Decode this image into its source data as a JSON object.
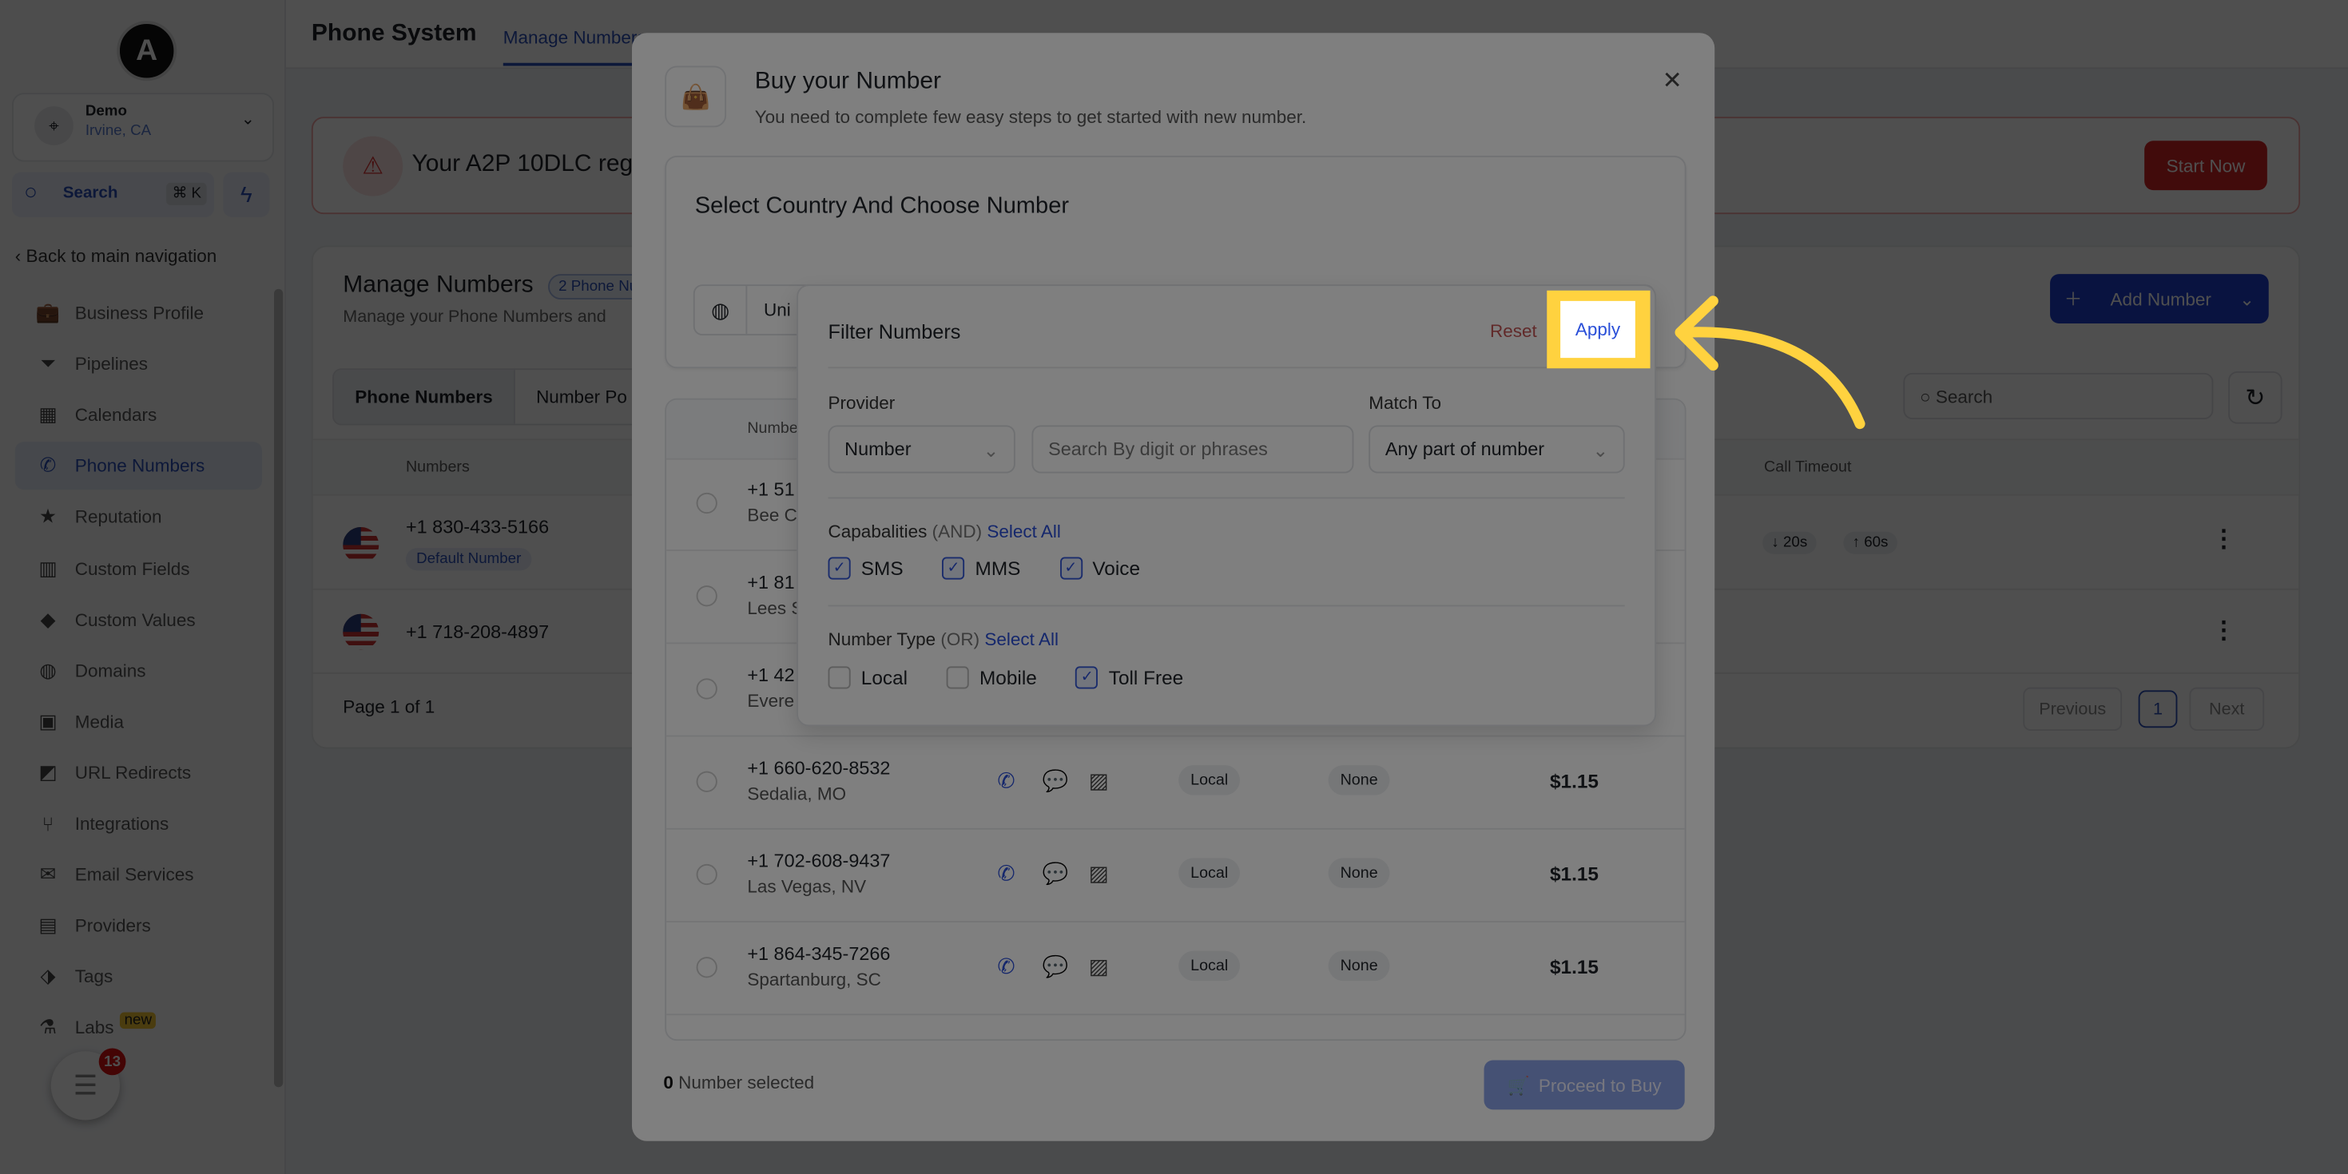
{
  "sidebar": {
    "logo_letter": "A",
    "location": {
      "name": "Demo",
      "city": "Irvine, CA"
    },
    "search": {
      "label": "Search",
      "shortcut": "⌘ K"
    },
    "back_label": "Back to main navigation",
    "items": [
      {
        "label": "Business Profile",
        "icon": "briefcase-icon",
        "glyph": "💼"
      },
      {
        "label": "Pipelines",
        "icon": "funnel-icon",
        "glyph": "⏷"
      },
      {
        "label": "Calendars",
        "icon": "calendar-icon",
        "glyph": "▦"
      },
      {
        "label": "Phone Numbers",
        "icon": "phone-icon",
        "glyph": "✆",
        "active": true
      },
      {
        "label": "Reputation",
        "icon": "star-icon",
        "glyph": "★"
      },
      {
        "label": "Custom Fields",
        "icon": "fields-icon",
        "glyph": "▥"
      },
      {
        "label": "Custom Values",
        "icon": "diamond-icon",
        "glyph": "◆"
      },
      {
        "label": "Domains",
        "icon": "globe-icon",
        "glyph": "◍"
      },
      {
        "label": "Media",
        "icon": "media-icon",
        "glyph": "▣"
      },
      {
        "label": "URL Redirects",
        "icon": "redirect-icon",
        "glyph": "◩"
      },
      {
        "label": "Integrations",
        "icon": "integrations-icon",
        "glyph": "⑂"
      },
      {
        "label": "Email Services",
        "icon": "email-icon",
        "glyph": "✉"
      },
      {
        "label": "Providers",
        "icon": "clipboard-icon",
        "glyph": "▤"
      },
      {
        "label": "Tags",
        "icon": "tag-icon",
        "glyph": "⬗"
      },
      {
        "label": "Labs",
        "icon": "flask-icon",
        "glyph": "⚗",
        "badge": "new"
      }
    ],
    "chat_badge": "13"
  },
  "header": {
    "title": "Phone System",
    "tab": "Manage Numbers"
  },
  "alert": {
    "text": "Your A2P 10DLC reg",
    "button": "Start Now"
  },
  "manage": {
    "title": "Manage Numbers",
    "count_badge": "2 Phone Nu",
    "subtitle": "Manage your Phone Numbers and",
    "add_button": "Add Number",
    "tabs": [
      "Phone Numbers",
      "Number Po"
    ],
    "search_placeholder": "Search",
    "columns": {
      "numbers": "Numbers",
      "call_timeout": "Call Timeout"
    },
    "rows": [
      {
        "number": "+1 830-433-5166",
        "badge": "Default Number",
        "timeout_in": "↓ 20s",
        "timeout_out": "↑ 60s"
      },
      {
        "number": "+1 718-208-4897"
      }
    ],
    "page_info": "Page 1 of 1",
    "prev": "Previous",
    "page": "1",
    "next": "Next"
  },
  "modal": {
    "title": "Buy your Number",
    "subtitle": "You need to complete few easy steps to get started with new number.",
    "section_title": "Select Country And Choose Number",
    "country_value": "Uni",
    "table_header": "Numbe",
    "rows": [
      {
        "number": "+1 51",
        "city": "Bee C"
      },
      {
        "number": "+1 81",
        "city": "Lees S"
      },
      {
        "number": "+1 42",
        "city": "Evere"
      },
      {
        "number": "+1 660-620-8532",
        "city": "Sedalia, MO",
        "type": "Local",
        "extra": "None",
        "price": "$1.15"
      },
      {
        "number": "+1 702-608-9437",
        "city": "Las Vegas, NV",
        "type": "Local",
        "extra": "None",
        "price": "$1.15"
      },
      {
        "number": "+1 864-345-7266",
        "city": "Spartanburg, SC",
        "type": "Local",
        "extra": "None",
        "price": "$1.15"
      }
    ],
    "selected_count": "0",
    "selected_label": " Number selected",
    "proceed": "Proceed to Buy"
  },
  "filter": {
    "title": "Filter Numbers",
    "reset": "Reset",
    "apply": "Apply",
    "provider_label": "Provider",
    "match_label": "Match To",
    "provider_value": "Number",
    "search_placeholder": "Search By digit or phrases",
    "match_value": "Any part of number",
    "capabilities": {
      "label": "Capabalities",
      "mode": "(AND)",
      "select_all": "Select All",
      "options": [
        {
          "label": "SMS",
          "checked": true
        },
        {
          "label": "MMS",
          "checked": true
        },
        {
          "label": "Voice",
          "checked": true
        }
      ]
    },
    "number_type": {
      "label": "Number Type",
      "mode": "(OR)",
      "select_all": "Select All",
      "options": [
        {
          "label": "Local",
          "checked": false
        },
        {
          "label": "Mobile",
          "checked": false
        },
        {
          "label": "Toll Free",
          "checked": true
        }
      ]
    }
  },
  "colors": {
    "highlight": "#ffd23f",
    "primary": "#1d3fd1",
    "danger": "#d42626"
  }
}
